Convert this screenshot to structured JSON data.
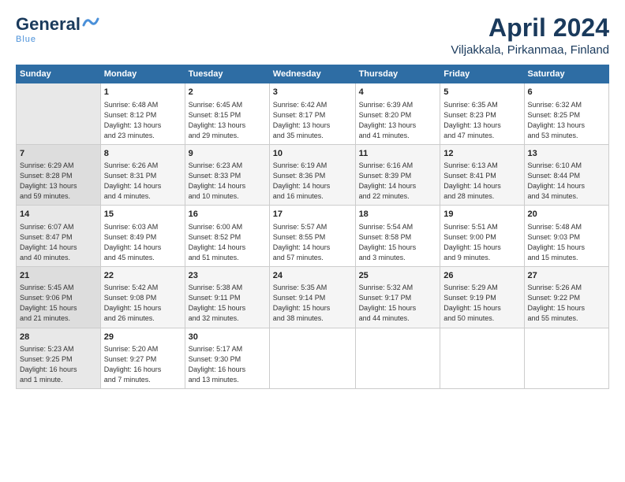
{
  "header": {
    "logo_general": "General",
    "logo_blue": "Blue",
    "logo_wave": "~",
    "title": "April 2024",
    "subtitle": "Viljakkala, Pirkanmaa, Finland"
  },
  "days_of_week": [
    "Sunday",
    "Monday",
    "Tuesday",
    "Wednesday",
    "Thursday",
    "Friday",
    "Saturday"
  ],
  "weeks": [
    [
      {
        "num": "",
        "info": ""
      },
      {
        "num": "1",
        "info": "Sunrise: 6:48 AM\nSunset: 8:12 PM\nDaylight: 13 hours\nand 23 minutes."
      },
      {
        "num": "2",
        "info": "Sunrise: 6:45 AM\nSunset: 8:15 PM\nDaylight: 13 hours\nand 29 minutes."
      },
      {
        "num": "3",
        "info": "Sunrise: 6:42 AM\nSunset: 8:17 PM\nDaylight: 13 hours\nand 35 minutes."
      },
      {
        "num": "4",
        "info": "Sunrise: 6:39 AM\nSunset: 8:20 PM\nDaylight: 13 hours\nand 41 minutes."
      },
      {
        "num": "5",
        "info": "Sunrise: 6:35 AM\nSunset: 8:23 PM\nDaylight: 13 hours\nand 47 minutes."
      },
      {
        "num": "6",
        "info": "Sunrise: 6:32 AM\nSunset: 8:25 PM\nDaylight: 13 hours\nand 53 minutes."
      }
    ],
    [
      {
        "num": "7",
        "info": "Sunrise: 6:29 AM\nSunset: 8:28 PM\nDaylight: 13 hours\nand 59 minutes."
      },
      {
        "num": "8",
        "info": "Sunrise: 6:26 AM\nSunset: 8:31 PM\nDaylight: 14 hours\nand 4 minutes."
      },
      {
        "num": "9",
        "info": "Sunrise: 6:23 AM\nSunset: 8:33 PM\nDaylight: 14 hours\nand 10 minutes."
      },
      {
        "num": "10",
        "info": "Sunrise: 6:19 AM\nSunset: 8:36 PM\nDaylight: 14 hours\nand 16 minutes."
      },
      {
        "num": "11",
        "info": "Sunrise: 6:16 AM\nSunset: 8:39 PM\nDaylight: 14 hours\nand 22 minutes."
      },
      {
        "num": "12",
        "info": "Sunrise: 6:13 AM\nSunset: 8:41 PM\nDaylight: 14 hours\nand 28 minutes."
      },
      {
        "num": "13",
        "info": "Sunrise: 6:10 AM\nSunset: 8:44 PM\nDaylight: 14 hours\nand 34 minutes."
      }
    ],
    [
      {
        "num": "14",
        "info": "Sunrise: 6:07 AM\nSunset: 8:47 PM\nDaylight: 14 hours\nand 40 minutes."
      },
      {
        "num": "15",
        "info": "Sunrise: 6:03 AM\nSunset: 8:49 PM\nDaylight: 14 hours\nand 45 minutes."
      },
      {
        "num": "16",
        "info": "Sunrise: 6:00 AM\nSunset: 8:52 PM\nDaylight: 14 hours\nand 51 minutes."
      },
      {
        "num": "17",
        "info": "Sunrise: 5:57 AM\nSunset: 8:55 PM\nDaylight: 14 hours\nand 57 minutes."
      },
      {
        "num": "18",
        "info": "Sunrise: 5:54 AM\nSunset: 8:58 PM\nDaylight: 15 hours\nand 3 minutes."
      },
      {
        "num": "19",
        "info": "Sunrise: 5:51 AM\nSunset: 9:00 PM\nDaylight: 15 hours\nand 9 minutes."
      },
      {
        "num": "20",
        "info": "Sunrise: 5:48 AM\nSunset: 9:03 PM\nDaylight: 15 hours\nand 15 minutes."
      }
    ],
    [
      {
        "num": "21",
        "info": "Sunrise: 5:45 AM\nSunset: 9:06 PM\nDaylight: 15 hours\nand 21 minutes."
      },
      {
        "num": "22",
        "info": "Sunrise: 5:42 AM\nSunset: 9:08 PM\nDaylight: 15 hours\nand 26 minutes."
      },
      {
        "num": "23",
        "info": "Sunrise: 5:38 AM\nSunset: 9:11 PM\nDaylight: 15 hours\nand 32 minutes."
      },
      {
        "num": "24",
        "info": "Sunrise: 5:35 AM\nSunset: 9:14 PM\nDaylight: 15 hours\nand 38 minutes."
      },
      {
        "num": "25",
        "info": "Sunrise: 5:32 AM\nSunset: 9:17 PM\nDaylight: 15 hours\nand 44 minutes."
      },
      {
        "num": "26",
        "info": "Sunrise: 5:29 AM\nSunset: 9:19 PM\nDaylight: 15 hours\nand 50 minutes."
      },
      {
        "num": "27",
        "info": "Sunrise: 5:26 AM\nSunset: 9:22 PM\nDaylight: 15 hours\nand 55 minutes."
      }
    ],
    [
      {
        "num": "28",
        "info": "Sunrise: 5:23 AM\nSunset: 9:25 PM\nDaylight: 16 hours\nand 1 minute."
      },
      {
        "num": "29",
        "info": "Sunrise: 5:20 AM\nSunset: 9:27 PM\nDaylight: 16 hours\nand 7 minutes."
      },
      {
        "num": "30",
        "info": "Sunrise: 5:17 AM\nSunset: 9:30 PM\nDaylight: 16 hours\nand 13 minutes."
      },
      {
        "num": "",
        "info": ""
      },
      {
        "num": "",
        "info": ""
      },
      {
        "num": "",
        "info": ""
      },
      {
        "num": "",
        "info": ""
      }
    ]
  ]
}
